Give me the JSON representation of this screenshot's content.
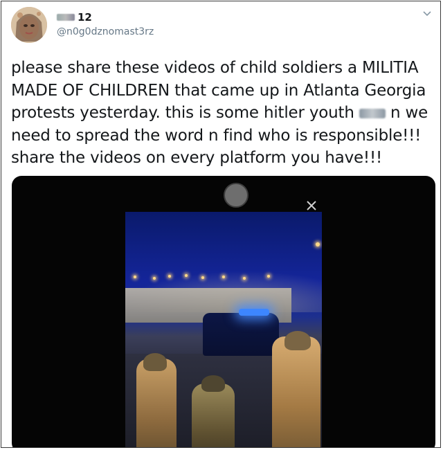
{
  "user": {
    "display_name_suffix": "12",
    "handle": "@n0g0dznomast3rz"
  },
  "tweet": {
    "text_part1": "please share these videos of child soldiers a MILITIA MADE OF CHILDREN that came up in Atlanta Georgia protests yesterday. this is some hitler youth ",
    "text_part2": "n we need to spread the word n find who is responsible!!! share the videos on every platform you have!!!"
  },
  "icons": {
    "menu": "chevron-down-icon",
    "pause": "pause-icon",
    "close": "close-icon"
  },
  "colors": {
    "text": "#14171a",
    "handle": "#657786",
    "media_bg": "#050505"
  }
}
